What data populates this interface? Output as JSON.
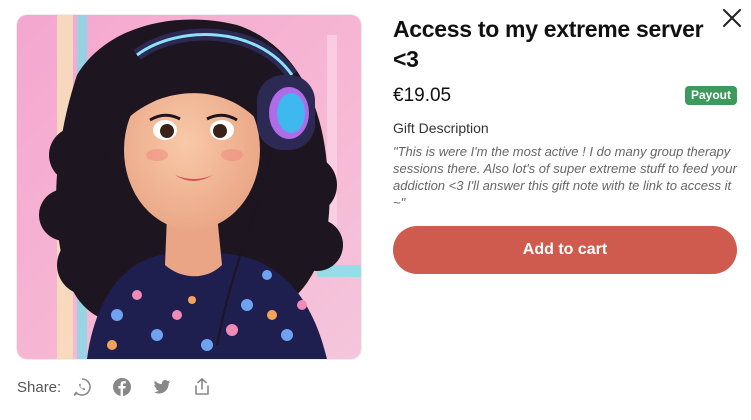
{
  "product": {
    "title": "Access to my extreme server <3",
    "price": "€19.05",
    "badge": "Payout",
    "description_label": "Gift Description",
    "description": "\"This is were I'm the most active ! I do many group therapy sessions there. Also lot's of super extreme stuff to feed your addiction <3 I'll answer this gift note with te link to access it ~\"",
    "image_icon": "avatar-illustration"
  },
  "actions": {
    "add_to_cart": "Add to cart",
    "close_icon": "close-icon"
  },
  "share": {
    "label": "Share:",
    "icons": [
      "whatsapp-icon",
      "facebook-icon",
      "twitter-icon",
      "share-upload-icon"
    ]
  },
  "colors": {
    "button": "#cf5a4e",
    "badge": "#3e9a5c"
  }
}
